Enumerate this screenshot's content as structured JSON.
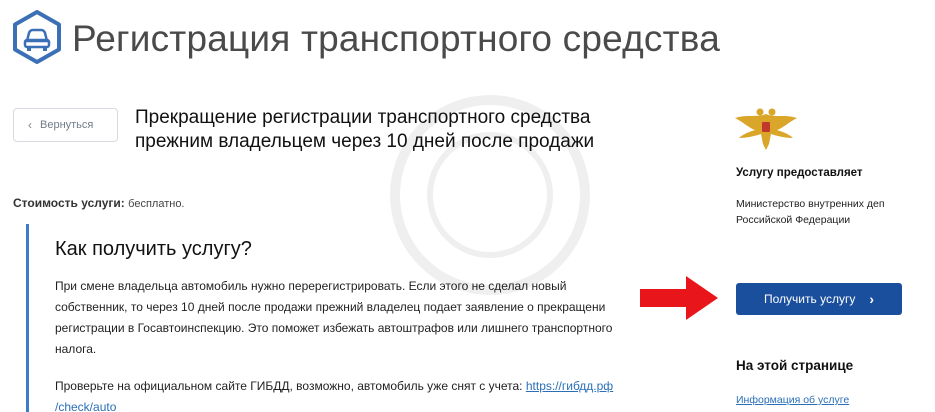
{
  "header": {
    "title": "Регистрация транспортного средства",
    "icon": "car-icon",
    "icon_color": "#3b6fb6"
  },
  "back_button": {
    "label": "Вернуться",
    "icon": "chevron-left-icon"
  },
  "service": {
    "title_line1": "Прекращение регистрации транспортного средства",
    "title_line2": "прежним владельцем через  10 дней после продажи"
  },
  "cost": {
    "label": "Стоимость услуги:",
    "value": "бесплатно."
  },
  "how_to": {
    "heading": "Как получить услугу?",
    "text_line1": "При смене владельца автомобиль нужно перерегистрировать. Если этого не сделал новый",
    "text_line2": "собственник, то через 10 дней после продажи прежний владелец подает заявление о прекращени",
    "text_line3": "регистрации в Госавтоинспекцию. Это поможет избежать автоштрафов или лишнего транспортного",
    "text_line4": "налога.",
    "check_text": "Проверьте на официальном сайте ГИБДД, возможно, автомобиль уже снят с учета: ",
    "check_link_line1": "https://гибдд.рф",
    "check_link_line2": "/check/auto",
    "accent_color": "#3d7cc9"
  },
  "sidebar": {
    "emblem": "eagle-emblem-icon",
    "provider_label": "Услугу предоставляет",
    "provider_name_line1": "Министерство внутренних деп",
    "provider_name_line2": "Российской Федерации",
    "get_service_label": "Получить услугу",
    "button_color": "#1a4f9e",
    "on_page_heading": "На этой странице",
    "on_page_link": "Информация об услуге"
  },
  "annotation": {
    "icon": "red-arrow-icon",
    "color": "#e8161b"
  }
}
